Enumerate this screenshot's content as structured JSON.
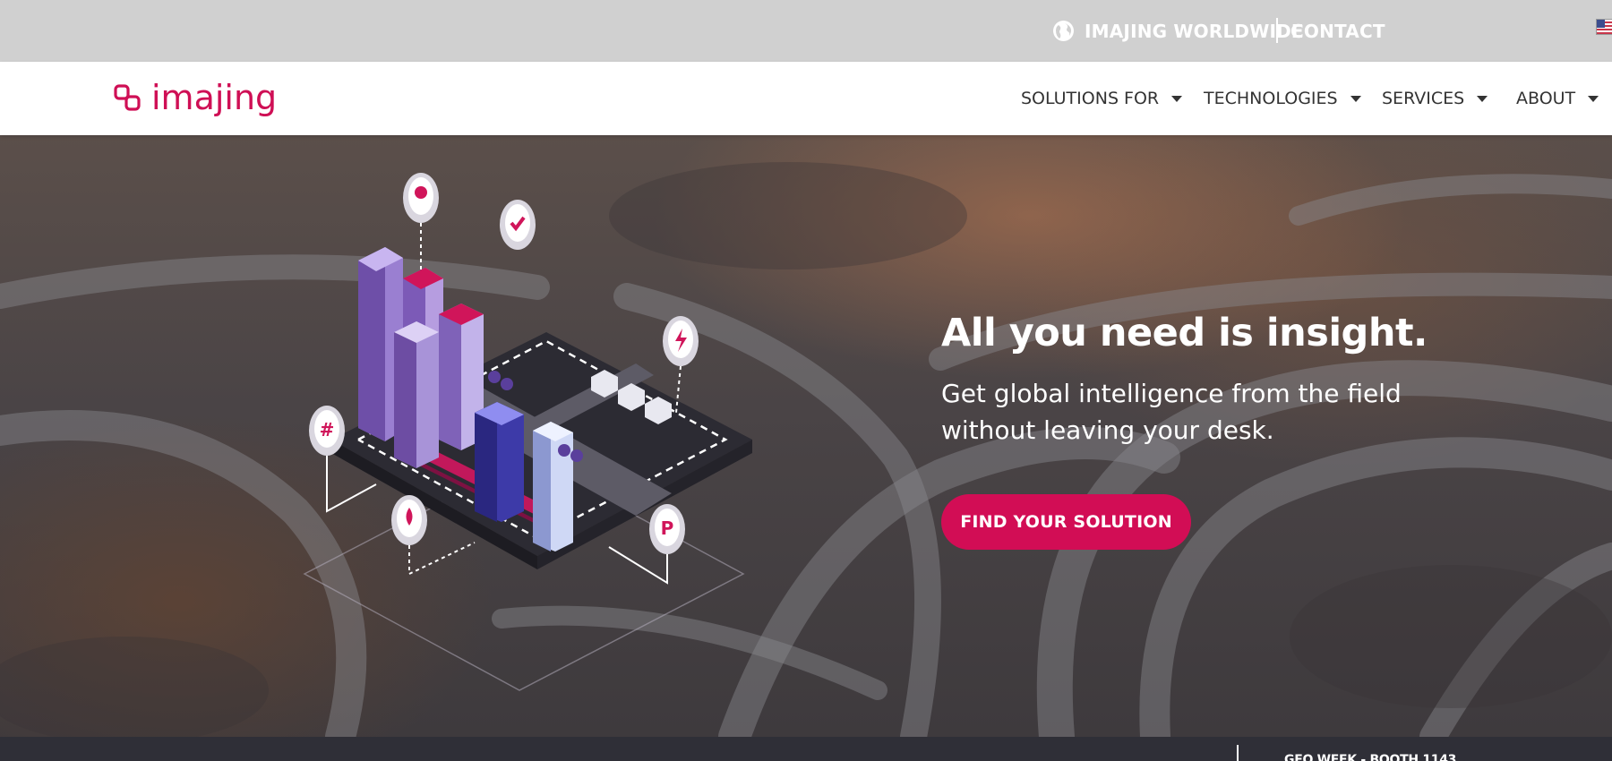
{
  "topbar": {
    "worldwide_label": "IMAJING WORLDWIDE",
    "contact_label": "CONTACT",
    "globe_icon": "globe-icon",
    "flag_icon": "us-flag-icon"
  },
  "brand": {
    "logo_text": "imajing",
    "color": "#cf0f55"
  },
  "nav": {
    "items": [
      {
        "label": "SOLUTIONS FOR",
        "icon": "caret-down-icon"
      },
      {
        "label": "TECHNOLOGIES",
        "icon": "caret-down-icon"
      },
      {
        "label": "SERVICES",
        "icon": "caret-down-icon"
      },
      {
        "label": "ABOUT",
        "icon": "caret-down-icon"
      }
    ]
  },
  "hero": {
    "title": "All you need is insight.",
    "subtitle_line1": "Get global intelligence from the field",
    "subtitle_line2": "without leaving your desk.",
    "cta_label": "FIND YOUR SOLUTION",
    "accent_color": "#d20d55"
  },
  "bottom": {
    "event_text": "GEO WEEK - BOOTH 1143"
  }
}
